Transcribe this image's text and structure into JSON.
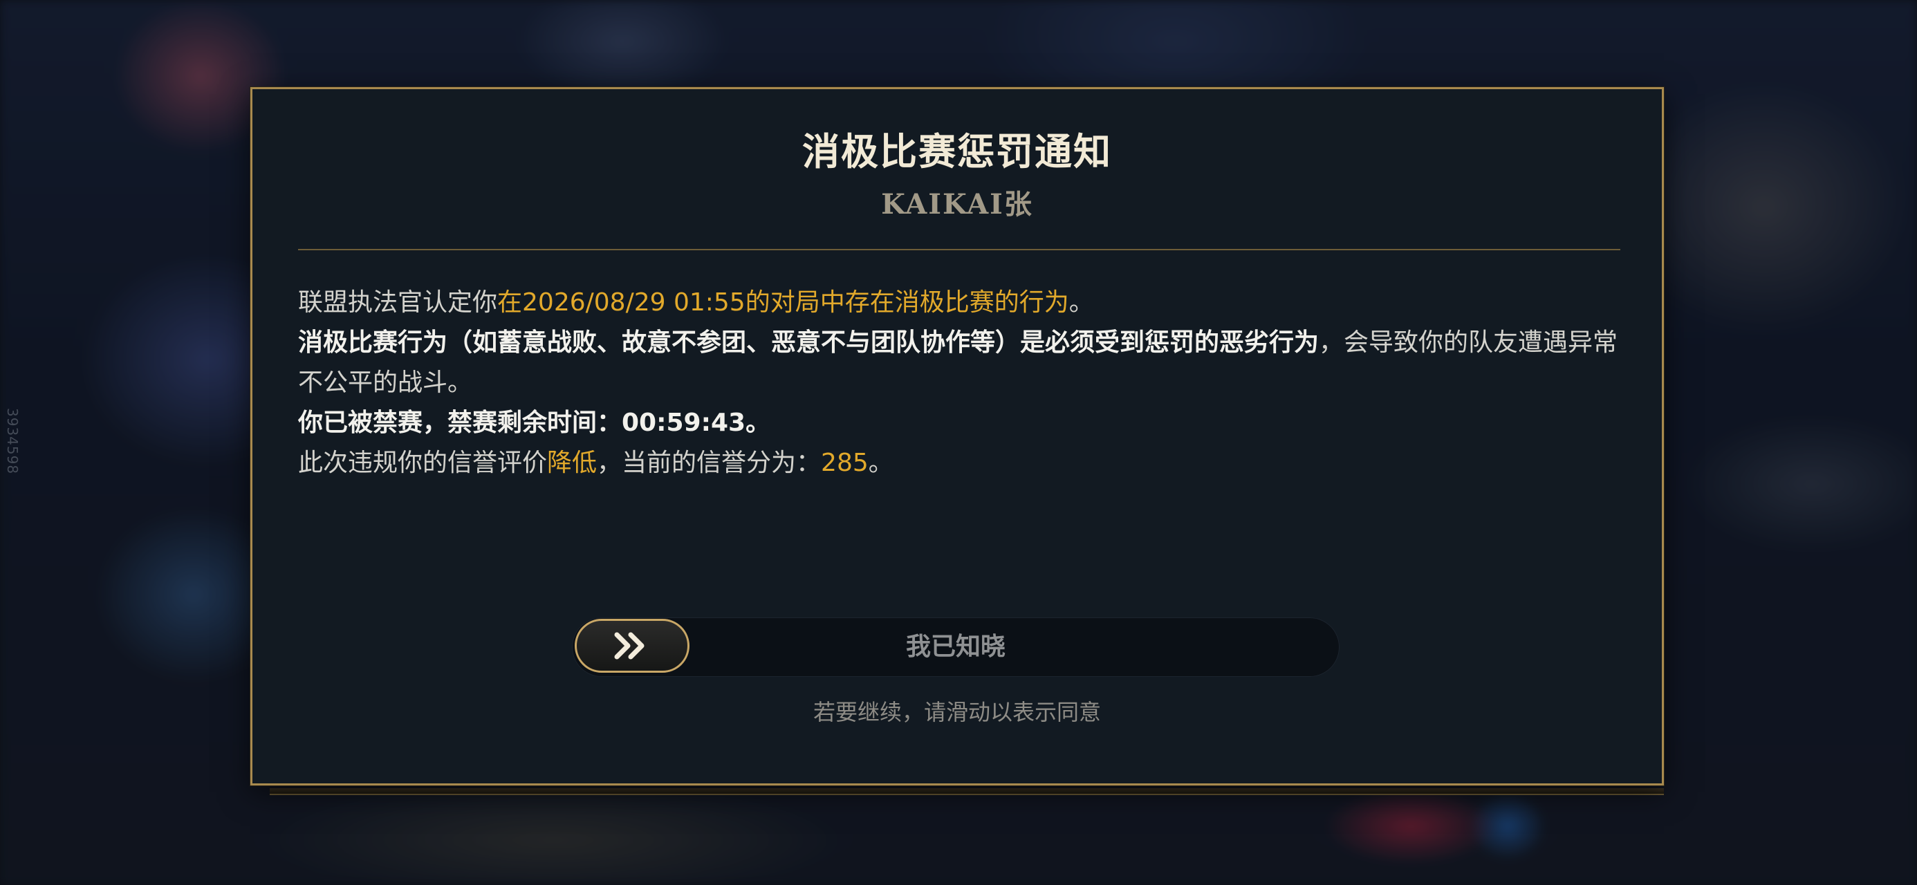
{
  "background": {
    "side_id": "3934598"
  },
  "dialog": {
    "title": "消极比赛惩罚通知",
    "player_name": "KAIKAI张",
    "line1": {
      "prefix": "联盟执法官认定你",
      "highlight": "在2026/08/29 01:55的对局中存在消极比赛的行为",
      "suffix": "。"
    },
    "line2": {
      "bold": "消极比赛行为（如蓄意战败、故意不参团、恶意不与团队协作等）是必须受到惩罚的恶劣行为",
      "rest": "，会导致你的队友遭遇异常不公平的战斗。"
    },
    "line3": "你已被禁赛，禁赛剩余时间：00:59:43。",
    "line4": {
      "prefix": "此次违规你的信誉评价",
      "highlight": "降低",
      "middle": "，当前的信誉分为：",
      "score": "285",
      "suffix": "。"
    },
    "slider_label": "我已知晓",
    "slider_icon": "double-chevron-right-icon",
    "hint": "若要继续，请滑动以表示同意"
  },
  "colors": {
    "accent_gold": "#e2a92b",
    "border_gold": "#a88a4e",
    "panel_bg": "#121a22"
  }
}
